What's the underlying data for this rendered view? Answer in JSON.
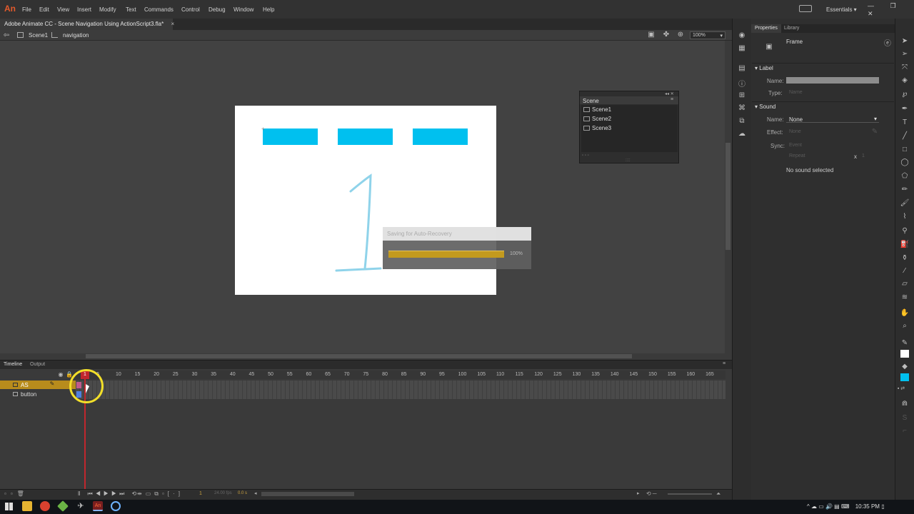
{
  "app": {
    "logo": "An"
  },
  "menu": [
    "File",
    "Edit",
    "View",
    "Insert",
    "Modify",
    "Text",
    "Commands",
    "Control",
    "Debug",
    "Window",
    "Help"
  ],
  "workspace": {
    "label": "Essentials ▾"
  },
  "document": {
    "tab_title": "Adobe Animate CC - Scene Navigation Using ActionScript3.fla*",
    "close_glyph": "×",
    "breadcrumb_scene": "Scene1",
    "breadcrumb_symbol": "navigation",
    "zoom": "100%"
  },
  "stage": {
    "big_digit": "1",
    "button_color": "#00c0ef"
  },
  "scene_panel": {
    "title": "Scene",
    "scenes": [
      "Scene1",
      "Scene2",
      "Scene3"
    ]
  },
  "saving_dialog": {
    "title": "Saving for Auto-Recovery",
    "percent": "100%",
    "progress": 1.0
  },
  "properties": {
    "tabs": [
      "Properties",
      "Library"
    ],
    "type_label": "Frame",
    "label_section": "Label",
    "name_label": "Name:",
    "type_field_label": "Type:",
    "type_value": "Name",
    "sound_section": "Sound",
    "sound_name_value": "None",
    "effect_label": "Effect:",
    "effect_value": "None",
    "sync_label": "Sync:",
    "sync_value": "Event",
    "repeat_value": "Repeat",
    "repeat_x": "x",
    "repeat_count": "1",
    "no_sound": "No sound selected"
  },
  "timeline": {
    "tabs": [
      "Timeline",
      "Output"
    ],
    "layers": [
      "AS",
      "button"
    ],
    "ruler": [
      "1",
      "5",
      "10",
      "15",
      "20",
      "25",
      "30",
      "35",
      "40",
      "45",
      "50",
      "55",
      "60",
      "65",
      "70",
      "75",
      "80",
      "85",
      "90",
      "95",
      "100",
      "105",
      "110",
      "115",
      "120",
      "125",
      "130",
      "135",
      "140",
      "145",
      "150",
      "155",
      "160",
      "165"
    ],
    "current_frame": "1",
    "fps": "24.00 fps",
    "elapsed": "0.0 s"
  },
  "taskbar": {
    "time": "10:35 PM"
  },
  "colors": {
    "accent_orange": "#e35a2c",
    "layer_active": "#b88c1c",
    "playhead": "#c0272d",
    "progress": "#c39a1e",
    "highlight_circle": "#f2df2a"
  }
}
